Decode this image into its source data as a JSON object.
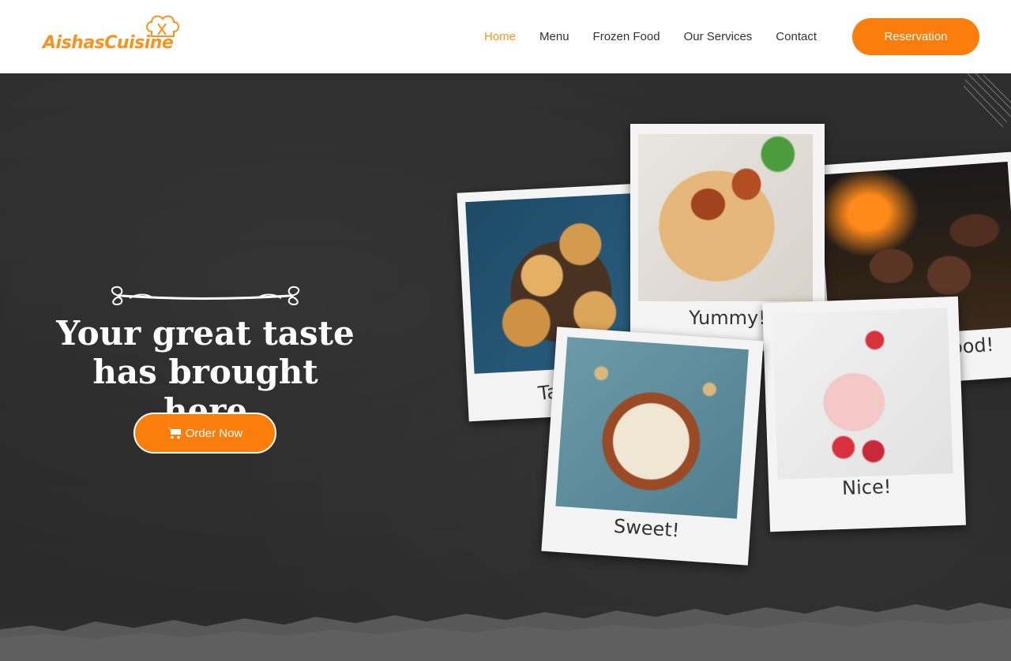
{
  "header": {
    "logo_text": "AishasCuisine",
    "nav": [
      {
        "label": "Home",
        "active": true
      },
      {
        "label": "Menu",
        "active": false
      },
      {
        "label": "Frozen Food",
        "active": false
      },
      {
        "label": "Our Services",
        "active": false
      },
      {
        "label": "Contact",
        "active": false
      }
    ],
    "reservation_label": "Reservation"
  },
  "hero": {
    "headline_line1": "Your great taste",
    "headline_line2": "has brought here",
    "order_button_label": "Order Now",
    "order_button_icon": "shopping-cart-icon"
  },
  "gallery": {
    "captions": [
      "Tasty!",
      "Yummy!",
      "Good!",
      "Sweet!",
      "Nice!"
    ]
  },
  "colors": {
    "accent": "#fb7d0b",
    "logo": "#f7931e",
    "nav_text": "#333333",
    "hero_background": "#2b2b2b"
  }
}
